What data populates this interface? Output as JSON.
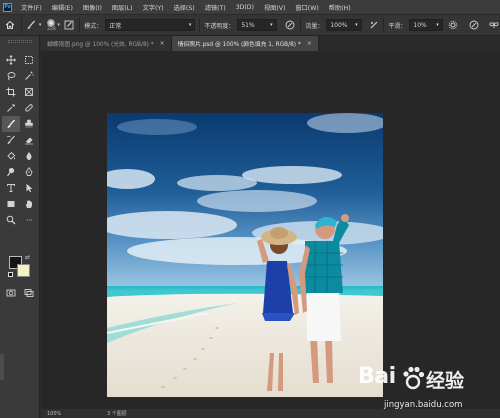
{
  "menubar": {
    "logo": "Ps",
    "items": [
      "文件(F)",
      "编辑(E)",
      "图像(I)",
      "图层(L)",
      "文字(Y)",
      "选择(S)",
      "滤镜(T)",
      "3D(D)",
      "视图(V)",
      "窗口(W)",
      "帮助(H)"
    ]
  },
  "options": {
    "brush_size": "228",
    "mode_label": "模式：",
    "mode_value": "正常",
    "opacity_label": "不透明度：",
    "opacity_value": "51%",
    "flow_label": "流量：",
    "flow_value": "100%",
    "smoothing_label": "平滑：",
    "smoothing_value": "10%"
  },
  "tabs": [
    {
      "label": "蝴蝶抠图.png @ 100% (光效, RGB/8) *",
      "close": "×"
    },
    {
      "label": "情侣照片.psd @ 100% (颜色填充 1, RGB/8) *",
      "close": "×"
    }
  ],
  "status": {
    "zoom": "100%",
    "info": "3 个图层"
  },
  "watermark": {
    "brand": "Bai",
    "text": "经验",
    "url": "jingyan.baidu.com"
  },
  "colors": {
    "foreground": "#151515",
    "background": "#f3f3c6",
    "accent": "#31a8ff"
  }
}
